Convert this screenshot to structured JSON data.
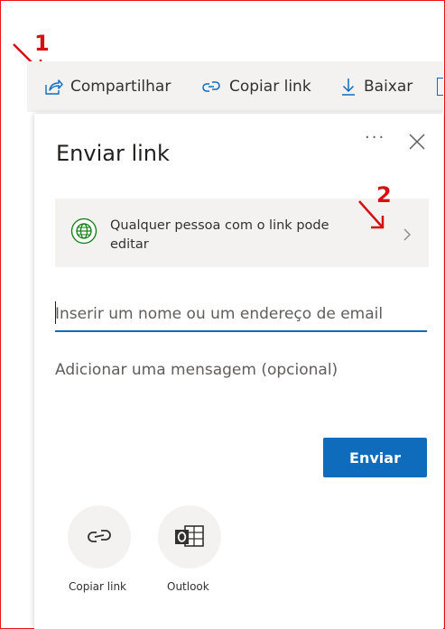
{
  "annotations": {
    "step1": "1",
    "step2": "2"
  },
  "toolbar": {
    "share": "Compartilhar",
    "copy_link": "Copiar link",
    "download": "Baixar"
  },
  "dialog": {
    "title": "Enviar link",
    "permission_text": "Qualquer pessoa com o link pode editar",
    "recipient_placeholder": "Inserir um nome ou um endereço de email",
    "message_placeholder": "Adicionar uma mensagem (opcional)",
    "send_label": "Enviar",
    "share_options": [
      {
        "label": "Copiar link",
        "icon": "link-icon"
      },
      {
        "label": "Outlook",
        "icon": "outlook-icon"
      }
    ]
  },
  "colors": {
    "accent": "#0f6cbd",
    "annotation": "#e8141b",
    "globe_green": "#107c10"
  }
}
